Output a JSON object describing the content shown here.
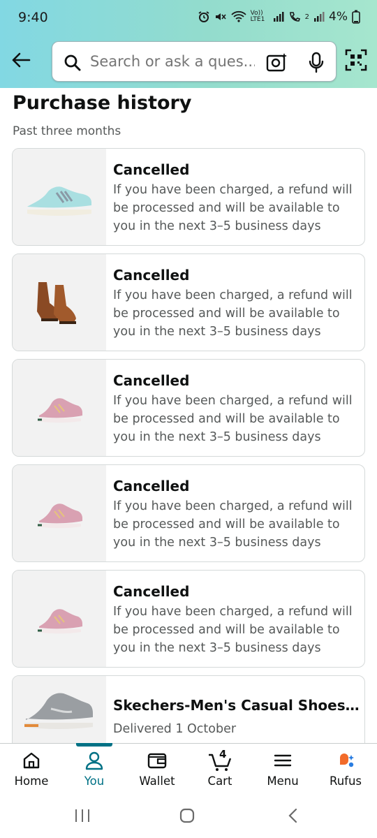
{
  "status_bar": {
    "time": "9:40",
    "network_label": "Vo)) LTE1",
    "sim2_label": "2",
    "battery": "4%"
  },
  "search": {
    "placeholder": "Search or ask a ques..."
  },
  "page": {
    "title": "Purchase history",
    "subtitle": "Past three months"
  },
  "orders": [
    {
      "status": "Cancelled",
      "message": "If you have been charged, a refund will be processed and will be available to you in the next 3–5 business days",
      "image": "light-blue-sneaker"
    },
    {
      "status": "Cancelled",
      "message": "If you have been charged, a refund will be processed and will be available to you in the next 3–5 business days",
      "image": "brown-ankle-boots"
    },
    {
      "status": "Cancelled",
      "message": "If you have been charged, a refund will be processed and will be available to you in the next 3–5 business days",
      "image": "pink-sneaker"
    },
    {
      "status": "Cancelled",
      "message": "If you have been charged, a refund will be processed and will be available to you in the next 3–5 business days",
      "image": "pink-sneaker"
    },
    {
      "status": "Cancelled",
      "message": "If you have been charged, a refund will be processed and will be available to you in the next 3–5 business days",
      "image": "pink-sneaker"
    }
  ],
  "last_order": {
    "title": "Skechers-Men's Casual Shoes-TE...",
    "delivery": "Delivered 1 October",
    "image": "grey-sneaker"
  },
  "bottom_nav": [
    {
      "label": "Home",
      "icon": "home-icon",
      "active": false
    },
    {
      "label": "You",
      "icon": "person-icon",
      "active": true
    },
    {
      "label": "Wallet",
      "icon": "wallet-icon",
      "active": false
    },
    {
      "label": "Cart",
      "icon": "cart-icon",
      "active": false,
      "badge": "4"
    },
    {
      "label": "Menu",
      "icon": "menu-icon",
      "active": false
    },
    {
      "label": "Rufus",
      "icon": "rufus-icon",
      "active": false
    }
  ],
  "colors": {
    "accent": "#007185",
    "header_start": "#82d8e3",
    "header_end": "#a6e6ce"
  }
}
